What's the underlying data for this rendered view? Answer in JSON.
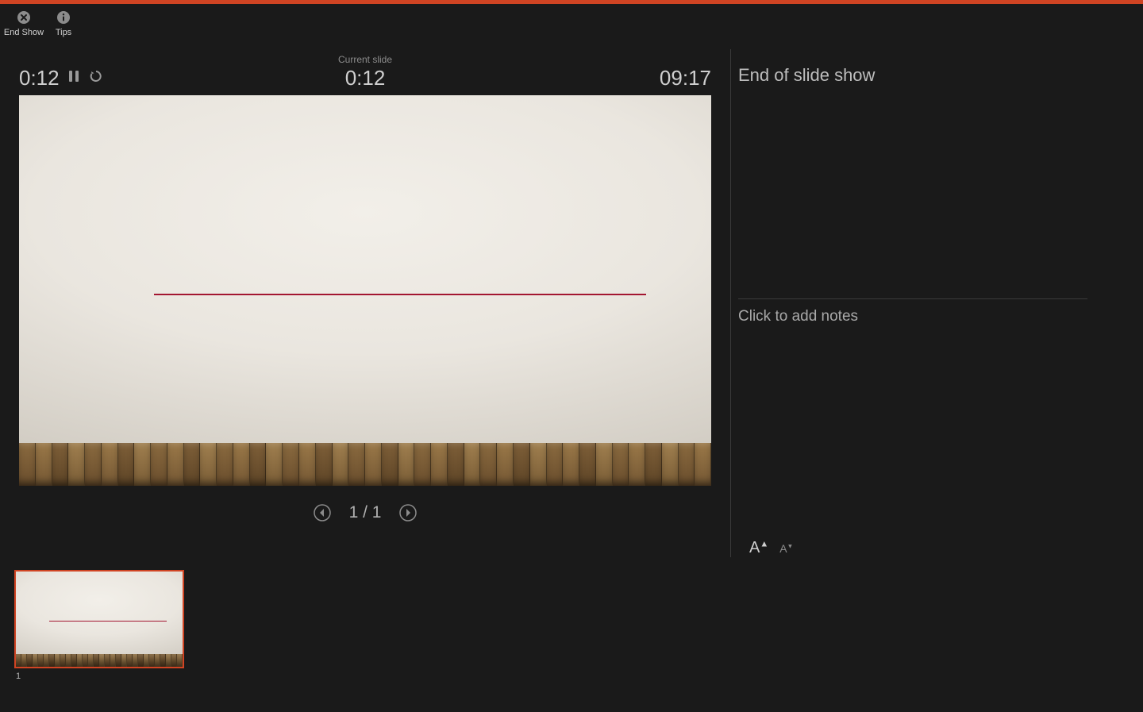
{
  "accent_color": "#d04423",
  "toolbar": {
    "end_show_label": "End Show",
    "tips_label": "Tips"
  },
  "timers": {
    "elapsed": "0:12",
    "current_slide_label": "Current slide",
    "current_slide_time": "0:12",
    "clock": "09:17"
  },
  "navigation": {
    "counter": "1 / 1"
  },
  "side_panel": {
    "message": "End of slide show",
    "notes_placeholder": "Click to add notes",
    "font_increase_label": "A",
    "font_decrease_label": "A"
  },
  "filmstrip": {
    "items": [
      {
        "index": "1"
      }
    ]
  }
}
